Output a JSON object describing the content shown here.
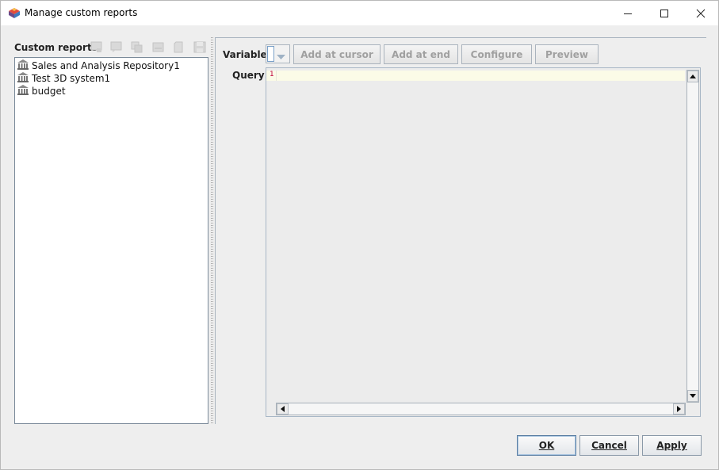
{
  "window": {
    "title": "Manage custom reports",
    "icon": "app-logo-icon"
  },
  "left_panel": {
    "title": "Custom reports",
    "toolbar_icons": [
      "new-report-icon",
      "edit-report-icon",
      "copy-report-icon",
      "rename-report-icon",
      "delete-report-icon",
      "save-report-icon"
    ],
    "items": [
      {
        "label": "Sales and Analysis Repository1",
        "icon": "repository-icon"
      },
      {
        "label": "Test 3D system1",
        "icon": "repository-icon"
      },
      {
        "label": "budget",
        "icon": "repository-icon"
      }
    ]
  },
  "query_panel": {
    "variable_label": "Variable:",
    "variable_value": "",
    "buttons": {
      "add_at_cursor": "Add at cursor",
      "add_at_end": "Add at end",
      "configure": "Configure",
      "preview": "Preview"
    },
    "query_label": "Query:",
    "line_number": "1",
    "query_text": ""
  },
  "dialog_buttons": {
    "ok": "OK",
    "cancel": "Cancel",
    "apply": "Apply"
  },
  "colors": {
    "disabled_text": "#a0a0a0",
    "line_number": "#c0003a",
    "current_line": "#fbfbe7"
  }
}
